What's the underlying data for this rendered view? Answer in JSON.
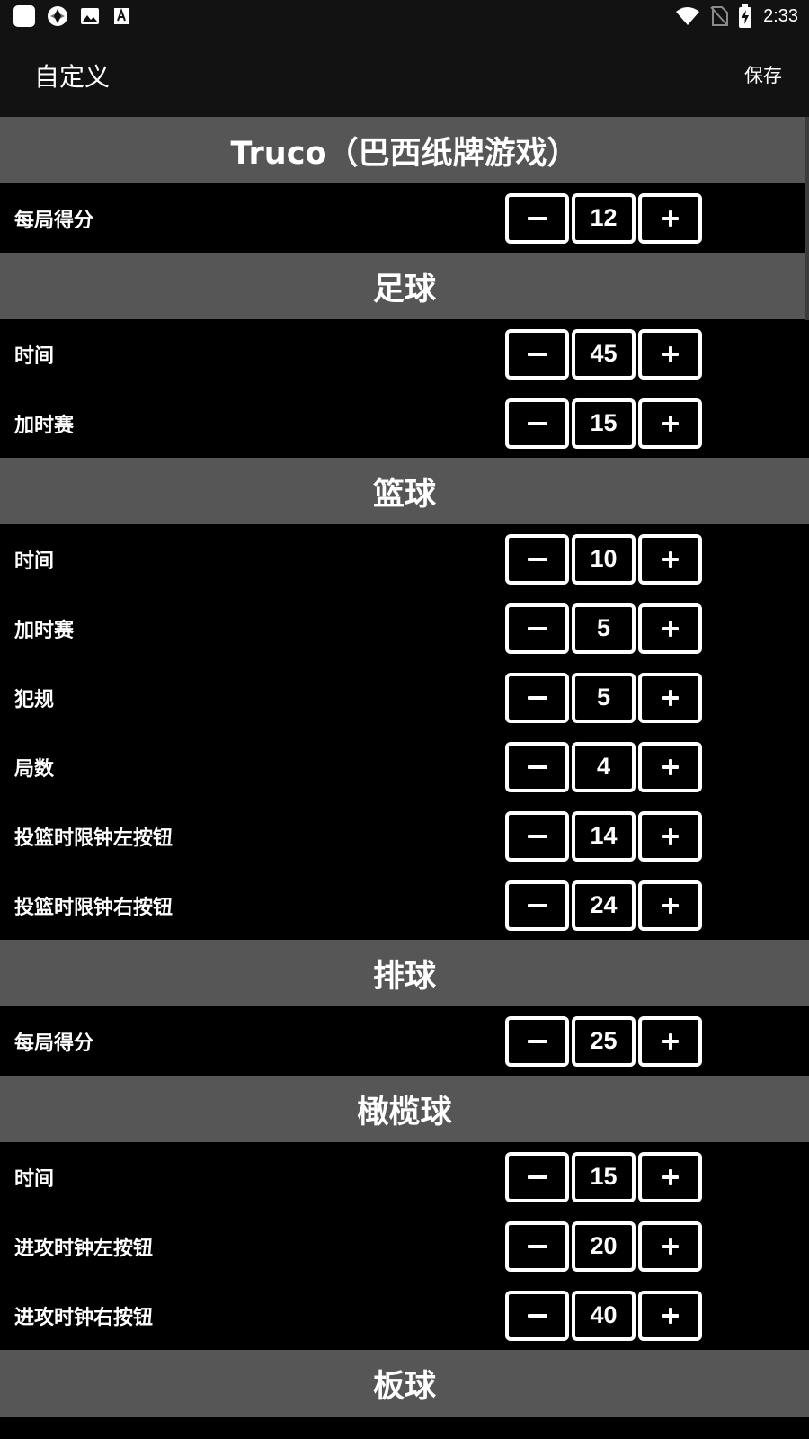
{
  "status_bar": {
    "time": "2:33",
    "left_icons": [
      "app-square-icon",
      "aperture-icon",
      "image-icon",
      "font-a-icon"
    ],
    "right_icons": [
      "wifi-icon",
      "no-sim-icon",
      "battery-charging-icon"
    ]
  },
  "app_bar": {
    "title": "自定义",
    "save_label": "保存"
  },
  "sections": [
    {
      "title": "Truco（巴西纸牌游戏）",
      "settings": [
        {
          "label": "每局得分",
          "value": "12"
        }
      ]
    },
    {
      "title": "足球",
      "settings": [
        {
          "label": "时间",
          "value": "45"
        },
        {
          "label": "加时赛",
          "value": "15"
        }
      ]
    },
    {
      "title": "篮球",
      "settings": [
        {
          "label": "时间",
          "value": "10"
        },
        {
          "label": "加时赛",
          "value": "5"
        },
        {
          "label": "犯规",
          "value": "5"
        },
        {
          "label": "局数",
          "value": "4"
        },
        {
          "label": "投篮时限钟左按钮",
          "value": "14"
        },
        {
          "label": "投篮时限钟右按钮",
          "value": "24"
        }
      ]
    },
    {
      "title": "排球",
      "settings": [
        {
          "label": "每局得分",
          "value": "25"
        }
      ]
    },
    {
      "title": "橄榄球",
      "settings": [
        {
          "label": "时间",
          "value": "15"
        },
        {
          "label": "进攻时钟左按钮",
          "value": "20"
        },
        {
          "label": "进攻时钟右按钮",
          "value": "40"
        }
      ]
    },
    {
      "title": "板球",
      "settings": []
    }
  ],
  "colors": {
    "background": "#000000",
    "status_bar": "#121212",
    "section_header": "#565656",
    "text": "#ffffff"
  }
}
